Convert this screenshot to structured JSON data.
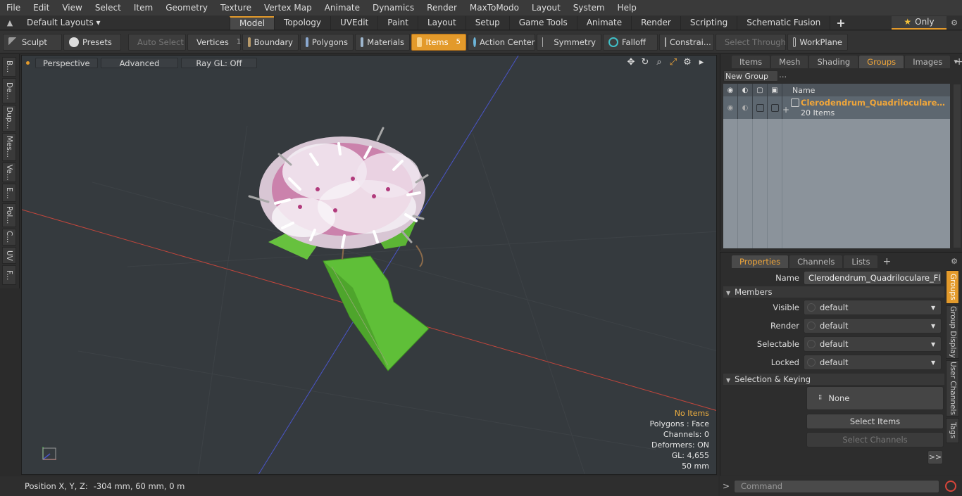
{
  "menu": [
    "File",
    "Edit",
    "View",
    "Select",
    "Item",
    "Geometry",
    "Texture",
    "Vertex Map",
    "Animate",
    "Dynamics",
    "Render",
    "MaxToModo",
    "Layout",
    "System",
    "Help"
  ],
  "layout_bar": {
    "layouts_label": "Default Layouts ▾",
    "tabs": [
      "Model",
      "Topology",
      "UVEdit",
      "Paint",
      "Layout",
      "Setup",
      "Game Tools",
      "Animate",
      "Render",
      "Scripting",
      "Schematic Fusion"
    ],
    "active_tab": "Model",
    "plus": "+",
    "only_label": "Only"
  },
  "toolbar": {
    "sculpt": "Sculpt",
    "presets": "Presets",
    "auto_select": "Auto Select",
    "vertices": "Vertices",
    "vertices_count": "1",
    "boundary": "Boundary",
    "polygons": "Polygons",
    "materials": "Materials",
    "items": "Items",
    "items_count": "5",
    "action_center": "Action Center",
    "symmetry": "Symmetry",
    "falloff": "Falloff",
    "constraints": "Constrai...",
    "select_through": "Select Through",
    "workplane": "WorkPlane"
  },
  "left_tabs": [
    "B...",
    "De...",
    "Dup...",
    "Mes...",
    "Ve...",
    "E...",
    "Pol...",
    "C...",
    "UV",
    "F..."
  ],
  "viewport": {
    "perspective": "Perspective",
    "advanced": "Advanced",
    "raygl": "Ray GL: Off",
    "info": {
      "no_items": "No Items",
      "polygons": "Polygons : Face",
      "channels": "Channels: 0",
      "deformers": "Deformers: ON",
      "gl": "GL: 4,655",
      "scale": "50 mm"
    }
  },
  "status": {
    "position_label": "Position X, Y, Z:",
    "position_value": "-304 mm, 60 mm, 0 m"
  },
  "items_panel": {
    "tabs": [
      "Items",
      "Mesh ...",
      "Shading",
      "Groups",
      "Images"
    ],
    "active_tab": "Groups",
    "plus": "+",
    "new_group": "New Group",
    "name_header": "Name",
    "group_name": "Clerodendrum_Quadriloculare_F...",
    "group_count": "20 Items"
  },
  "properties_panel": {
    "tabs": [
      "Properties",
      "Channels",
      "Lists"
    ],
    "active_tab": "Properties",
    "plus": "+",
    "name_label": "Name",
    "name_value": "Clerodendrum_Quadriloculare_Flower",
    "members_section": "Members",
    "visible_label": "Visible",
    "visible_value": "default",
    "render_label": "Render",
    "render_value": "default",
    "selectable_label": "Selectable",
    "selectable_value": "default",
    "locked_label": "Locked",
    "locked_value": "default",
    "selection_section": "Selection & Keying",
    "none_label": "None",
    "select_items": "Select Items",
    "select_channels": "Select Channels",
    "more": ">>",
    "side_tabs": [
      "Groups",
      "Group Display",
      "User Channels",
      "Tags"
    ]
  },
  "command": {
    "prompt": ">",
    "placeholder": "Command"
  },
  "colors": {
    "accent": "#e39a2b",
    "viewport_bg": "#353a3e",
    "highlight_text": "#f0a63a"
  }
}
